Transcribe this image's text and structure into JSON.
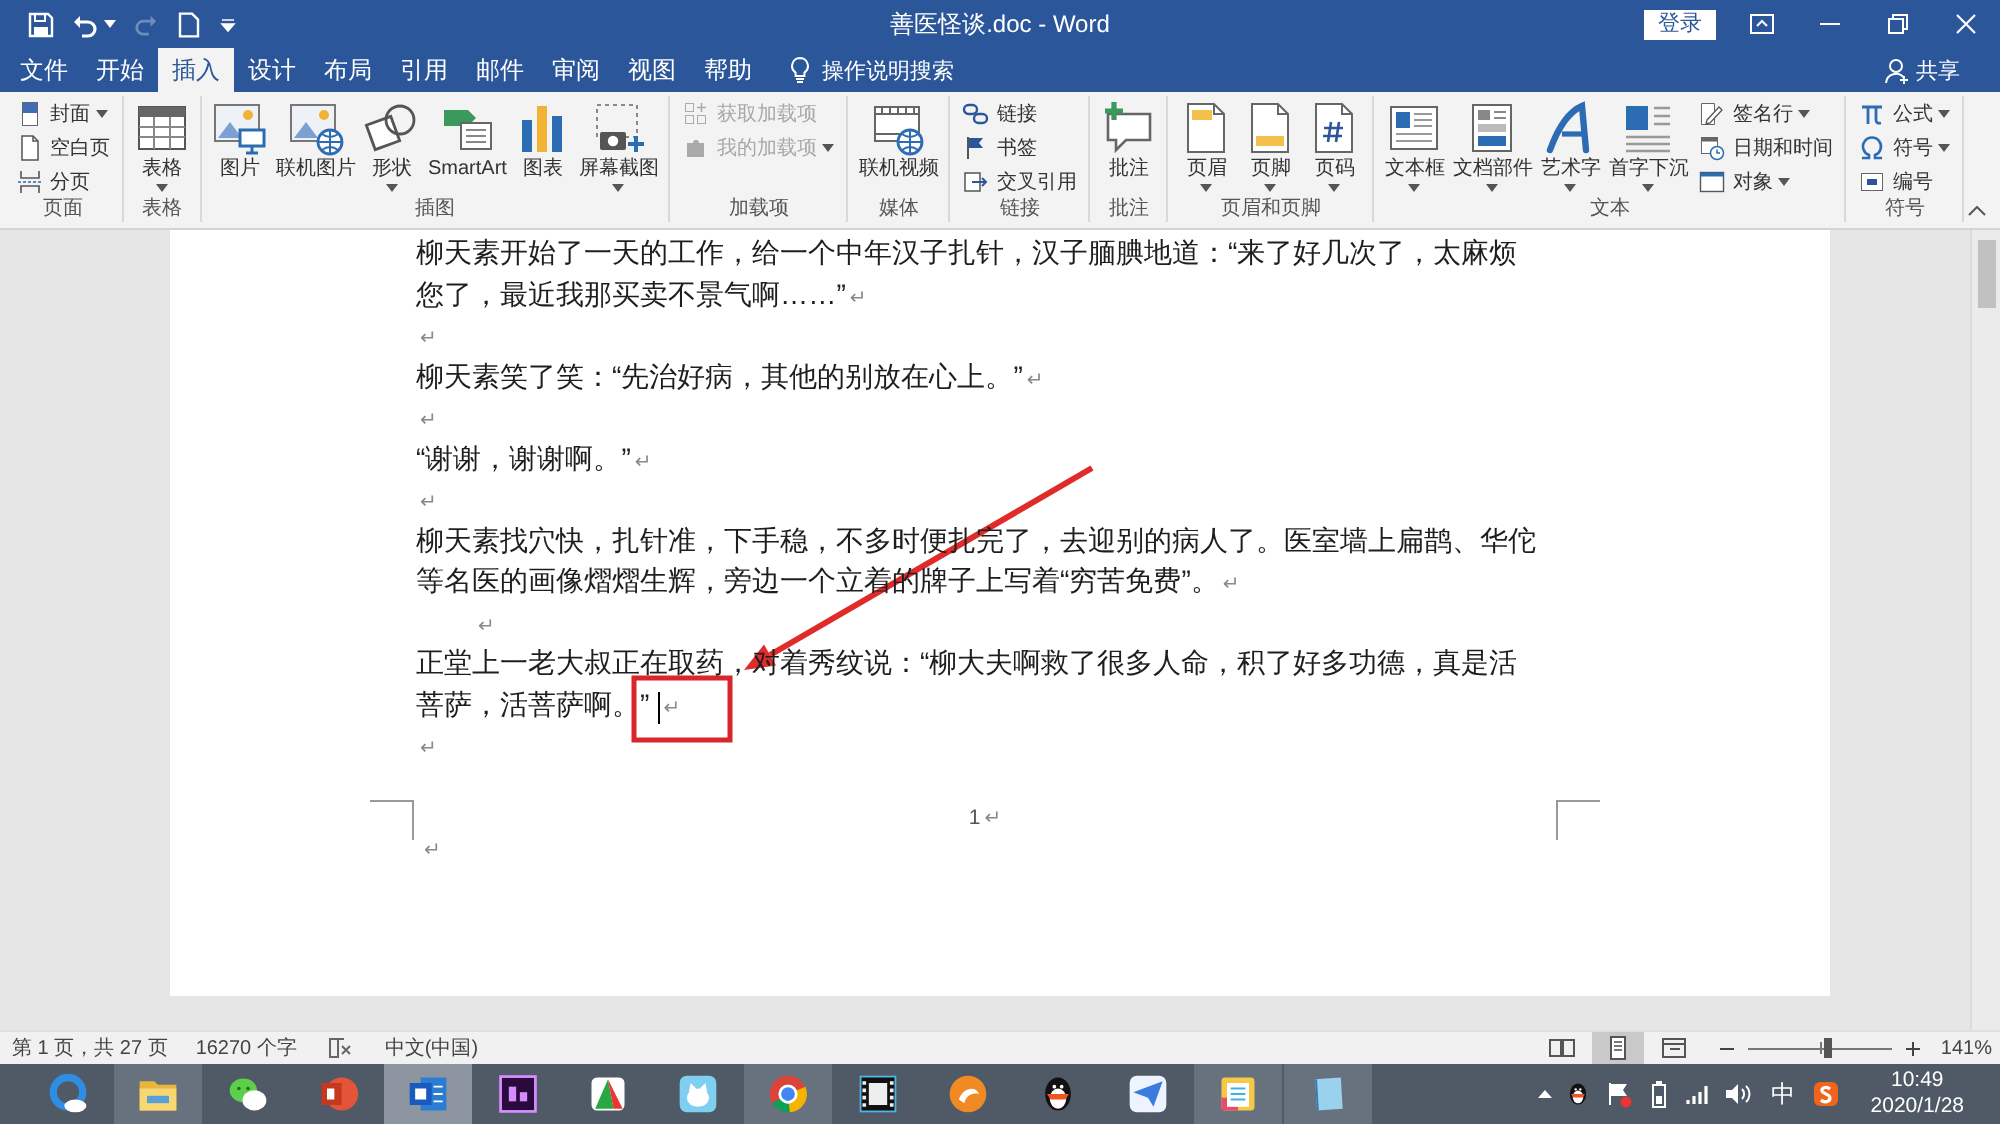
{
  "title_bar": {
    "title": "善医怪谈.doc - Word",
    "sign_in": "登录"
  },
  "tabs": [
    {
      "label": "文件",
      "selected": false
    },
    {
      "label": "开始",
      "selected": false
    },
    {
      "label": "插入",
      "selected": true
    },
    {
      "label": "设计",
      "selected": false
    },
    {
      "label": "布局",
      "selected": false
    },
    {
      "label": "引用",
      "selected": false
    },
    {
      "label": "邮件",
      "selected": false
    },
    {
      "label": "审阅",
      "selected": false
    },
    {
      "label": "视图",
      "selected": false
    },
    {
      "label": "帮助",
      "selected": false
    }
  ],
  "tell_me": "操作说明搜索",
  "share": "共享",
  "ribbon": {
    "groups": [
      {
        "label": "页面",
        "items": [
          {
            "label": "封面",
            "kind": "small",
            "menu": true,
            "disabled": false
          },
          {
            "label": "空白页",
            "kind": "small",
            "menu": false,
            "disabled": false
          },
          {
            "label": "分页",
            "kind": "small",
            "menu": false,
            "disabled": false
          }
        ]
      },
      {
        "label": "表格",
        "items": [
          {
            "label": "表格",
            "kind": "large",
            "menu": true,
            "disabled": false
          }
        ]
      },
      {
        "label": "插图",
        "items": [
          {
            "label": "图片",
            "kind": "large",
            "menu": false,
            "disabled": false
          },
          {
            "label": "联机图片",
            "kind": "large",
            "menu": false,
            "disabled": false
          },
          {
            "label": "形状",
            "kind": "large",
            "menu": true,
            "disabled": false
          },
          {
            "label": "SmartArt",
            "kind": "large",
            "menu": false,
            "disabled": false
          },
          {
            "label": "图表",
            "kind": "large",
            "menu": false,
            "disabled": false
          },
          {
            "label": "屏幕截图",
            "kind": "large",
            "menu": true,
            "disabled": false
          }
        ]
      },
      {
        "label": "加载项",
        "items": [
          {
            "label": "获取加载项",
            "kind": "small",
            "menu": false,
            "disabled": true
          },
          {
            "label": "我的加载项",
            "kind": "small",
            "menu": true,
            "disabled": true
          }
        ]
      },
      {
        "label": "媒体",
        "items": [
          {
            "label": "联机视频",
            "kind": "large",
            "menu": false,
            "disabled": false
          }
        ]
      },
      {
        "label": "链接",
        "items": [
          {
            "label": "链接",
            "kind": "small",
            "menu": false,
            "disabled": false
          },
          {
            "label": "书签",
            "kind": "small",
            "menu": false,
            "disabled": false
          },
          {
            "label": "交叉引用",
            "kind": "small",
            "menu": false,
            "disabled": false
          }
        ]
      },
      {
        "label": "批注",
        "items": [
          {
            "label": "批注",
            "kind": "large",
            "menu": false,
            "disabled": false
          }
        ]
      },
      {
        "label": "页眉和页脚",
        "items": [
          {
            "label": "页眉",
            "kind": "large",
            "menu": true,
            "disabled": false
          },
          {
            "label": "页脚",
            "kind": "large",
            "menu": true,
            "disabled": false
          },
          {
            "label": "页码",
            "kind": "large",
            "menu": true,
            "disabled": false
          }
        ]
      },
      {
        "label": "文本",
        "items": [
          {
            "label": "文本框",
            "kind": "large",
            "menu": true,
            "disabled": false
          },
          {
            "label": "文档部件",
            "kind": "large",
            "menu": true,
            "disabled": false
          },
          {
            "label": "艺术字",
            "kind": "large",
            "menu": true,
            "disabled": false
          },
          {
            "label": "首字下沉",
            "kind": "large",
            "menu": true,
            "disabled": false
          },
          {
            "label": "签名行",
            "kind": "small",
            "menu": true,
            "disabled": false
          },
          {
            "label": "日期和时间",
            "kind": "small",
            "menu": false,
            "disabled": false
          },
          {
            "label": "对象",
            "kind": "small",
            "menu": true,
            "disabled": false
          }
        ]
      },
      {
        "label": "符号",
        "items": [
          {
            "label": "公式",
            "kind": "small",
            "menu": true,
            "disabled": false
          },
          {
            "label": "符号",
            "kind": "small",
            "menu": true,
            "disabled": false
          },
          {
            "label": "编号",
            "kind": "small",
            "menu": false,
            "disabled": false
          }
        ]
      }
    ]
  },
  "document": {
    "paragraphs": [
      {
        "kind": "text",
        "lines": [
          "柳天素开始了一天的工作，给一个中年汉子扎针，汉子腼腆地道：“来了好几次了，太麻烦",
          "您了，最近我那买卖不景气啊……”"
        ],
        "mark": "↵",
        "cursor": false
      },
      {
        "kind": "empty",
        "mark": "↵",
        "cursor": false
      },
      {
        "kind": "text",
        "lines": [
          "柳天素笑了笑：“先治好病，其他的别放在心上。”"
        ],
        "mark": "↵",
        "cursor": false
      },
      {
        "kind": "empty",
        "mark": "↵",
        "cursor": false
      },
      {
        "kind": "text",
        "lines": [
          "“谢谢，谢谢啊。”"
        ],
        "mark": "↵",
        "cursor": false
      },
      {
        "kind": "empty",
        "mark": "↵",
        "cursor": false
      },
      {
        "kind": "text",
        "lines": [
          "柳天素找穴快，扎针准，下手稳，不多时便扎完了，去迎别的病人了。医室墙上扁鹊、华佗",
          "等名医的画像熠熠生辉，旁边一个立着的牌子上写着“穷苦免费”。"
        ],
        "mark": "↵",
        "cursor": false
      },
      {
        "kind": "indented",
        "mark": "↵",
        "cursor": false
      },
      {
        "kind": "text",
        "lines": [
          "正堂上一老大叔正在取药，对着秀纹说：“柳大夫啊救了很多人命，积了好多功德，真是活",
          "菩萨，活菩萨啊。”"
        ],
        "mark": "↵",
        "cursor": true
      },
      {
        "kind": "empty",
        "mark": "↵",
        "cursor": false
      }
    ],
    "footer": {
      "page_number": "1",
      "page_number_mark": "↵",
      "mark": "↵"
    }
  },
  "status_bar": {
    "page": "第 1 页，共 27 页",
    "words": "16270 个字",
    "language": "中文(中国)",
    "views": [
      {
        "selected": false
      },
      {
        "selected": true
      },
      {
        "selected": false
      }
    ],
    "zoom": {
      "level": 0.55,
      "reading": "141%"
    }
  },
  "taskbar": {
    "apps": [
      {
        "running": false,
        "selected": false
      },
      {
        "running": true,
        "selected": false
      },
      {
        "running": false,
        "selected": false
      },
      {
        "running": false,
        "selected": false
      },
      {
        "running": true,
        "selected": true
      },
      {
        "running": false,
        "selected": false
      },
      {
        "running": false,
        "selected": false
      },
      {
        "running": false,
        "selected": false
      },
      {
        "running": true,
        "selected": false
      },
      {
        "running": false,
        "selected": false
      },
      {
        "running": false,
        "selected": false
      },
      {
        "running": false,
        "selected": false
      },
      {
        "running": false,
        "selected": false
      },
      {
        "running": true,
        "selected": false
      },
      {
        "running": true,
        "selected": false
      }
    ],
    "input_language": "中",
    "time": "10:49",
    "date": "2020/1/28"
  }
}
